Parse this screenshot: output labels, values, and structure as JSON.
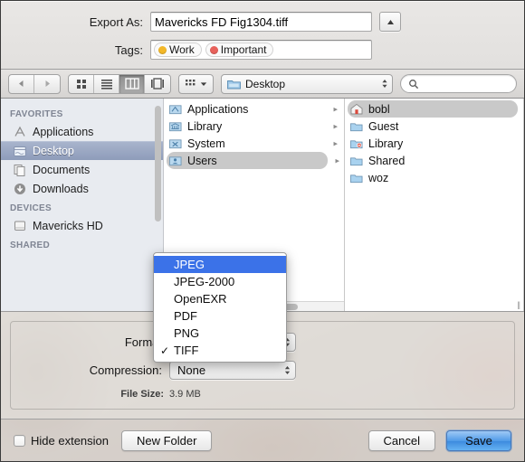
{
  "dialog": {
    "export_as_label": "Export As:",
    "filename": "Mavericks FD Fig1304.tiff",
    "tags_label": "Tags:",
    "tags": [
      {
        "name": "Work",
        "color": "#f3b829"
      },
      {
        "name": "Important",
        "color": "#e8625c"
      }
    ]
  },
  "toolbar": {
    "back_icon": "back-arrow-icon",
    "forward_icon": "forward-arrow-icon",
    "views": [
      {
        "name": "icon-view",
        "selected": false
      },
      {
        "name": "list-view",
        "selected": false
      },
      {
        "name": "column-view",
        "selected": true
      },
      {
        "name": "coverflow-view",
        "selected": false
      }
    ],
    "action_menu_icon": "action-grid-icon",
    "path_popup_value": "Desktop",
    "search_placeholder": ""
  },
  "sidebar": {
    "sections": [
      {
        "header": "FAVORITES",
        "items": [
          {
            "label": "Applications",
            "icon": "applications-icon",
            "selected": false
          },
          {
            "label": "Desktop",
            "icon": "desktop-folder-icon",
            "selected": true
          },
          {
            "label": "Documents",
            "icon": "documents-icon",
            "selected": false
          },
          {
            "label": "Downloads",
            "icon": "downloads-icon",
            "selected": false
          }
        ]
      },
      {
        "header": "DEVICES",
        "items": [
          {
            "label": "Mavericks HD",
            "icon": "hard-disk-icon",
            "selected": false
          }
        ]
      },
      {
        "header": "SHARED",
        "items": []
      }
    ]
  },
  "browser": {
    "column1": [
      {
        "label": "Applications",
        "icon": "applications-folder-icon",
        "has_arrow": true,
        "selected": false
      },
      {
        "label": "Library",
        "icon": "library-folder-icon",
        "has_arrow": true,
        "selected": false
      },
      {
        "label": "System",
        "icon": "system-folder-icon",
        "has_arrow": true,
        "selected": false
      },
      {
        "label": "Users",
        "icon": "users-folder-icon",
        "has_arrow": true,
        "selected": true
      }
    ],
    "column2": [
      {
        "label": "bobl",
        "icon": "home-folder-icon",
        "has_arrow": false,
        "selected": true
      },
      {
        "label": "Guest",
        "icon": "folder-icon",
        "has_arrow": false,
        "selected": false
      },
      {
        "label": "Library",
        "icon": "library-restricted-folder-icon",
        "has_arrow": false,
        "selected": false
      },
      {
        "label": "Shared",
        "icon": "folder-icon",
        "has_arrow": false,
        "selected": false
      },
      {
        "label": "woz",
        "icon": "folder-icon",
        "has_arrow": false,
        "selected": false
      }
    ]
  },
  "options": {
    "format_label": "Format",
    "format_value": "TIFF",
    "compression_label": "Compression:",
    "compression_value": "None",
    "filesize_label": "File Size:",
    "filesize_value": "3.9 MB"
  },
  "format_menu": {
    "items": [
      {
        "label": "JPEG",
        "checked": false,
        "highlighted": true
      },
      {
        "label": "JPEG-2000",
        "checked": false,
        "highlighted": false
      },
      {
        "label": "OpenEXR",
        "checked": false,
        "highlighted": false
      },
      {
        "label": "PDF",
        "checked": false,
        "highlighted": false
      },
      {
        "label": "PNG",
        "checked": false,
        "highlighted": false
      },
      {
        "label": "TIFF",
        "checked": true,
        "highlighted": false
      }
    ],
    "check_glyph": "✓"
  },
  "footer": {
    "hide_extension_label": "Hide extension",
    "hide_extension_checked": false,
    "new_folder_label": "New Folder",
    "cancel_label": "Cancel",
    "save_label": "Save"
  },
  "colors": {
    "menu_highlight": "#3b72e8",
    "default_button": "#4e9ae8",
    "sidebar_selection": "#8e9cba"
  }
}
